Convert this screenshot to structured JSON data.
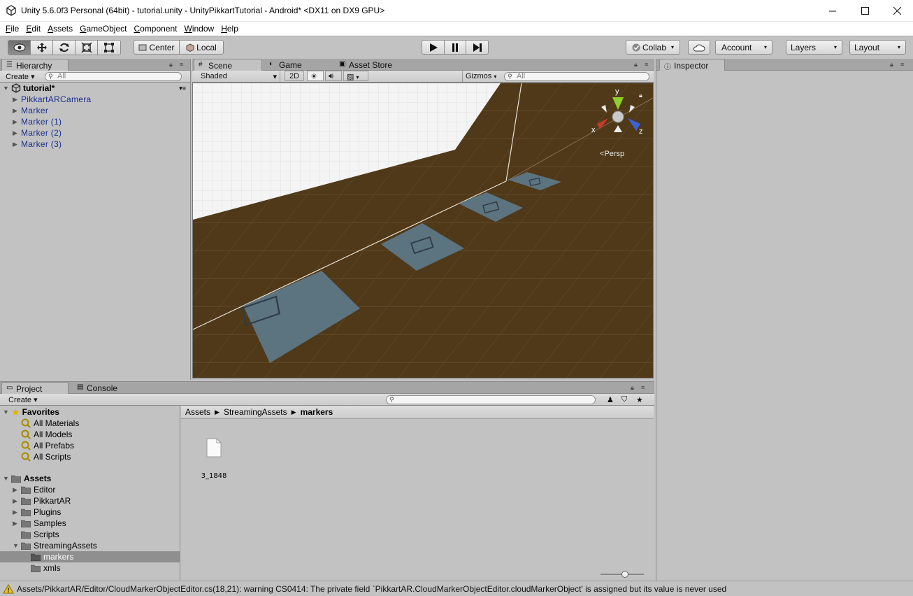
{
  "window": {
    "title": "Unity 5.6.0f3 Personal (64bit) - tutorial.unity - UnityPikkartTutorial - Android* <DX11 on DX9 GPU>"
  },
  "menu": [
    "File",
    "Edit",
    "Assets",
    "GameObject",
    "Component",
    "Window",
    "Help"
  ],
  "toolbar": {
    "pivot_label": "Center",
    "space_label": "Local",
    "collab_label": "Collab",
    "account_label": "Account",
    "layers_label": "Layers",
    "layout_label": "Layout"
  },
  "hierarchy": {
    "tab_label": "Hierarchy",
    "create_label": "Create",
    "search_placeholder": "All",
    "scene_name": "tutorial*",
    "items": [
      "PikkartARCamera",
      "Marker",
      "Marker (1)",
      "Marker (2)",
      "Marker (3)"
    ]
  },
  "scene": {
    "tabs": [
      "Scene",
      "Game",
      "Asset Store"
    ],
    "shading_label": "Shaded",
    "mode_2d_label": "2D",
    "gizmos_label": "Gizmos",
    "search_placeholder": "All",
    "axis_y": "y",
    "axis_x": "x",
    "axis_z": "z",
    "projection_label": "Persp"
  },
  "inspector": {
    "tab_label": "Inspector"
  },
  "project": {
    "tabs": [
      "Project",
      "Console"
    ],
    "create_label": "Create",
    "favorites_label": "Favorites",
    "favorites": [
      "All Materials",
      "All Models",
      "All Prefabs",
      "All Scripts"
    ],
    "assets_label": "Assets",
    "folders": [
      "Editor",
      "PikkartAR",
      "Plugins",
      "Samples",
      "Scripts",
      "StreamingAssets"
    ],
    "subfolders": [
      "markers",
      "xmls"
    ],
    "selected_folder": "markers",
    "breadcrumb": [
      "Assets",
      "StreamingAssets",
      "markers"
    ],
    "files": [
      "3_1848"
    ]
  },
  "status": {
    "message": "Assets/PikkartAR/Editor/CloudMarkerObjectEditor.cs(18,21): warning CS0414: The private field `PikkartAR.CloudMarkerObjectEditor.cloudMarkerObject' is assigned but its value is never used"
  },
  "colors": {
    "ground": "#4f3919",
    "marker": "#5d7a8c",
    "hierarchy_link": "#1d2f8c",
    "selection": "#8f8f8f"
  }
}
